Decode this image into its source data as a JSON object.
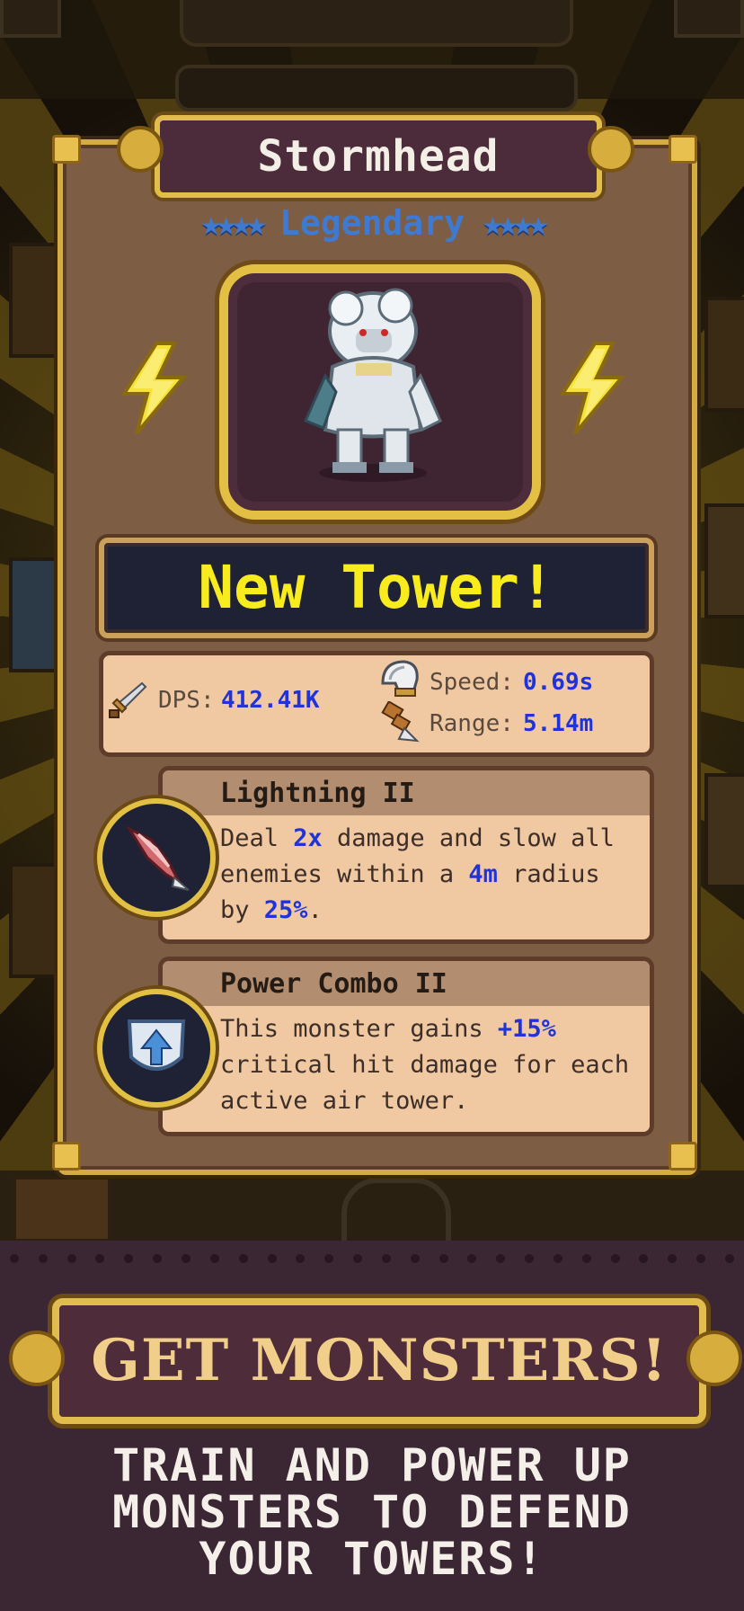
{
  "monster": {
    "name": "Stormhead",
    "rarity": "Legendary",
    "rarity_stars": 4
  },
  "banner_new": "New Tower!",
  "stats": {
    "dps_label": "DPS:",
    "dps_value": "412.41K",
    "speed_label": "Speed:",
    "speed_value": "0.69s",
    "range_label": "Range:",
    "range_value": "5.14m"
  },
  "abilities": [
    {
      "name": "Lightning II",
      "text_parts": [
        "Deal ",
        "2x",
        " damage and slow all enemies within a ",
        "4m",
        " radius by ",
        "25%",
        "."
      ]
    },
    {
      "name": "Power Combo II",
      "text_parts": [
        "This monster gains ",
        "+15%",
        " critical hit damage for each active air tower."
      ]
    }
  ],
  "promo": {
    "title": "GET MONSTERS!",
    "tagline_lines": [
      "TRAIN AND POWER UP",
      "MONSTERS TO DEFEND",
      "YOUR TOWERS!"
    ]
  },
  "colors": {
    "accent_blue": "#1f33d8",
    "rarity_blue": "#3f79d0",
    "gold_frame": "#e3bd4c",
    "new_tower_yellow": "#f8ec1f"
  }
}
